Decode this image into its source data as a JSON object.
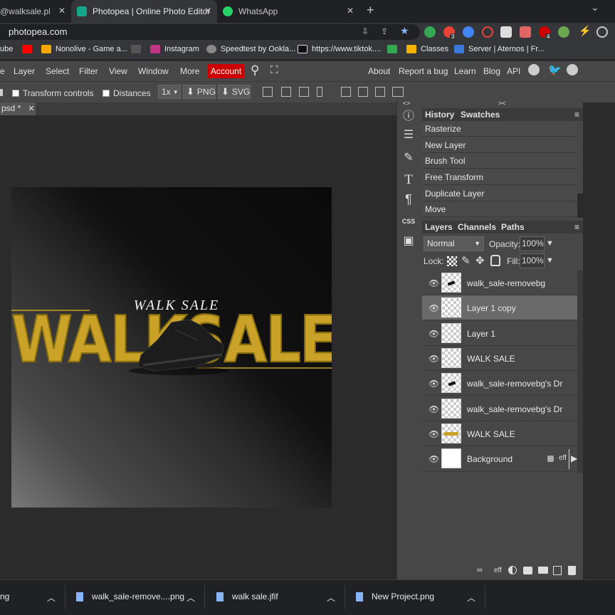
{
  "browser": {
    "tabs": [
      {
        "title": "@walksale.pk) • In",
        "active": false
      },
      {
        "title": "Photopea | Online Photo Editor",
        "active": true
      },
      {
        "title": "WhatsApp",
        "active": false
      }
    ],
    "new_tab": "+",
    "tab_list": "⌄",
    "url": "photopea.com",
    "bookmarks": [
      "ube",
      "Nonolive - Game a...",
      "Instagram",
      "Speedtest by Ookla...",
      "https://www.tiktok....",
      "Classes",
      "Server | Aternos | Fr..."
    ],
    "ext_badges": [
      "3",
      "4"
    ]
  },
  "photopea": {
    "menu": [
      "e",
      "Layer",
      "Select",
      "Filter",
      "View",
      "Window",
      "More"
    ],
    "account": "Account",
    "right_links": [
      "About",
      "Report a bug",
      "Learn",
      "Blog",
      "API"
    ],
    "options": {
      "transform_controls": "Transform controls",
      "distances": "Distances",
      "zoom": "1x",
      "png": "PNG",
      "svg": "SVG"
    },
    "doc_tab": "psd *",
    "collapse_left": "<>",
    "collapse_right": "><",
    "canvas_text": {
      "small": "WALK SALE",
      "big": "WALKSALE"
    },
    "history_tabs": [
      "History",
      "Swatches"
    ],
    "history": [
      "Rasterize",
      "New Layer",
      "Brush Tool",
      "Free Transform",
      "Duplicate Layer",
      "Move"
    ],
    "layer_tabs": [
      "Layers",
      "Channels",
      "Paths"
    ],
    "blend_mode": "Normal",
    "opacity_label": "Opacity:",
    "opacity": "100%",
    "lock_label": "Lock:",
    "fill_label": "Fill:",
    "fill": "100%",
    "layers": [
      {
        "name": "walk_sale-removebg",
        "selected": false
      },
      {
        "name": "Layer 1 copy",
        "selected": true
      },
      {
        "name": "Layer 1",
        "selected": false
      },
      {
        "name": "WALK SALE",
        "selected": false
      },
      {
        "name": "walk_sale-removebg's Dr",
        "selected": false
      },
      {
        "name": "walk_sale-removebg's Dr",
        "selected": false
      },
      {
        "name": "WALK SALE",
        "selected": false
      },
      {
        "name": "Background",
        "selected": false
      }
    ],
    "bg_eff": "eff",
    "bottom_eff": "eff",
    "side_css": "CSS",
    "menu_icon": "≡",
    "dropdown_arrow": "▼"
  },
  "downloads": [
    "ng",
    "walk_sale-remove....png",
    "walk sale.jfif",
    "New Project.png"
  ],
  "colors": {
    "accent_red": "#cc0000",
    "gold": "#c9a227",
    "panel": "#474747"
  }
}
